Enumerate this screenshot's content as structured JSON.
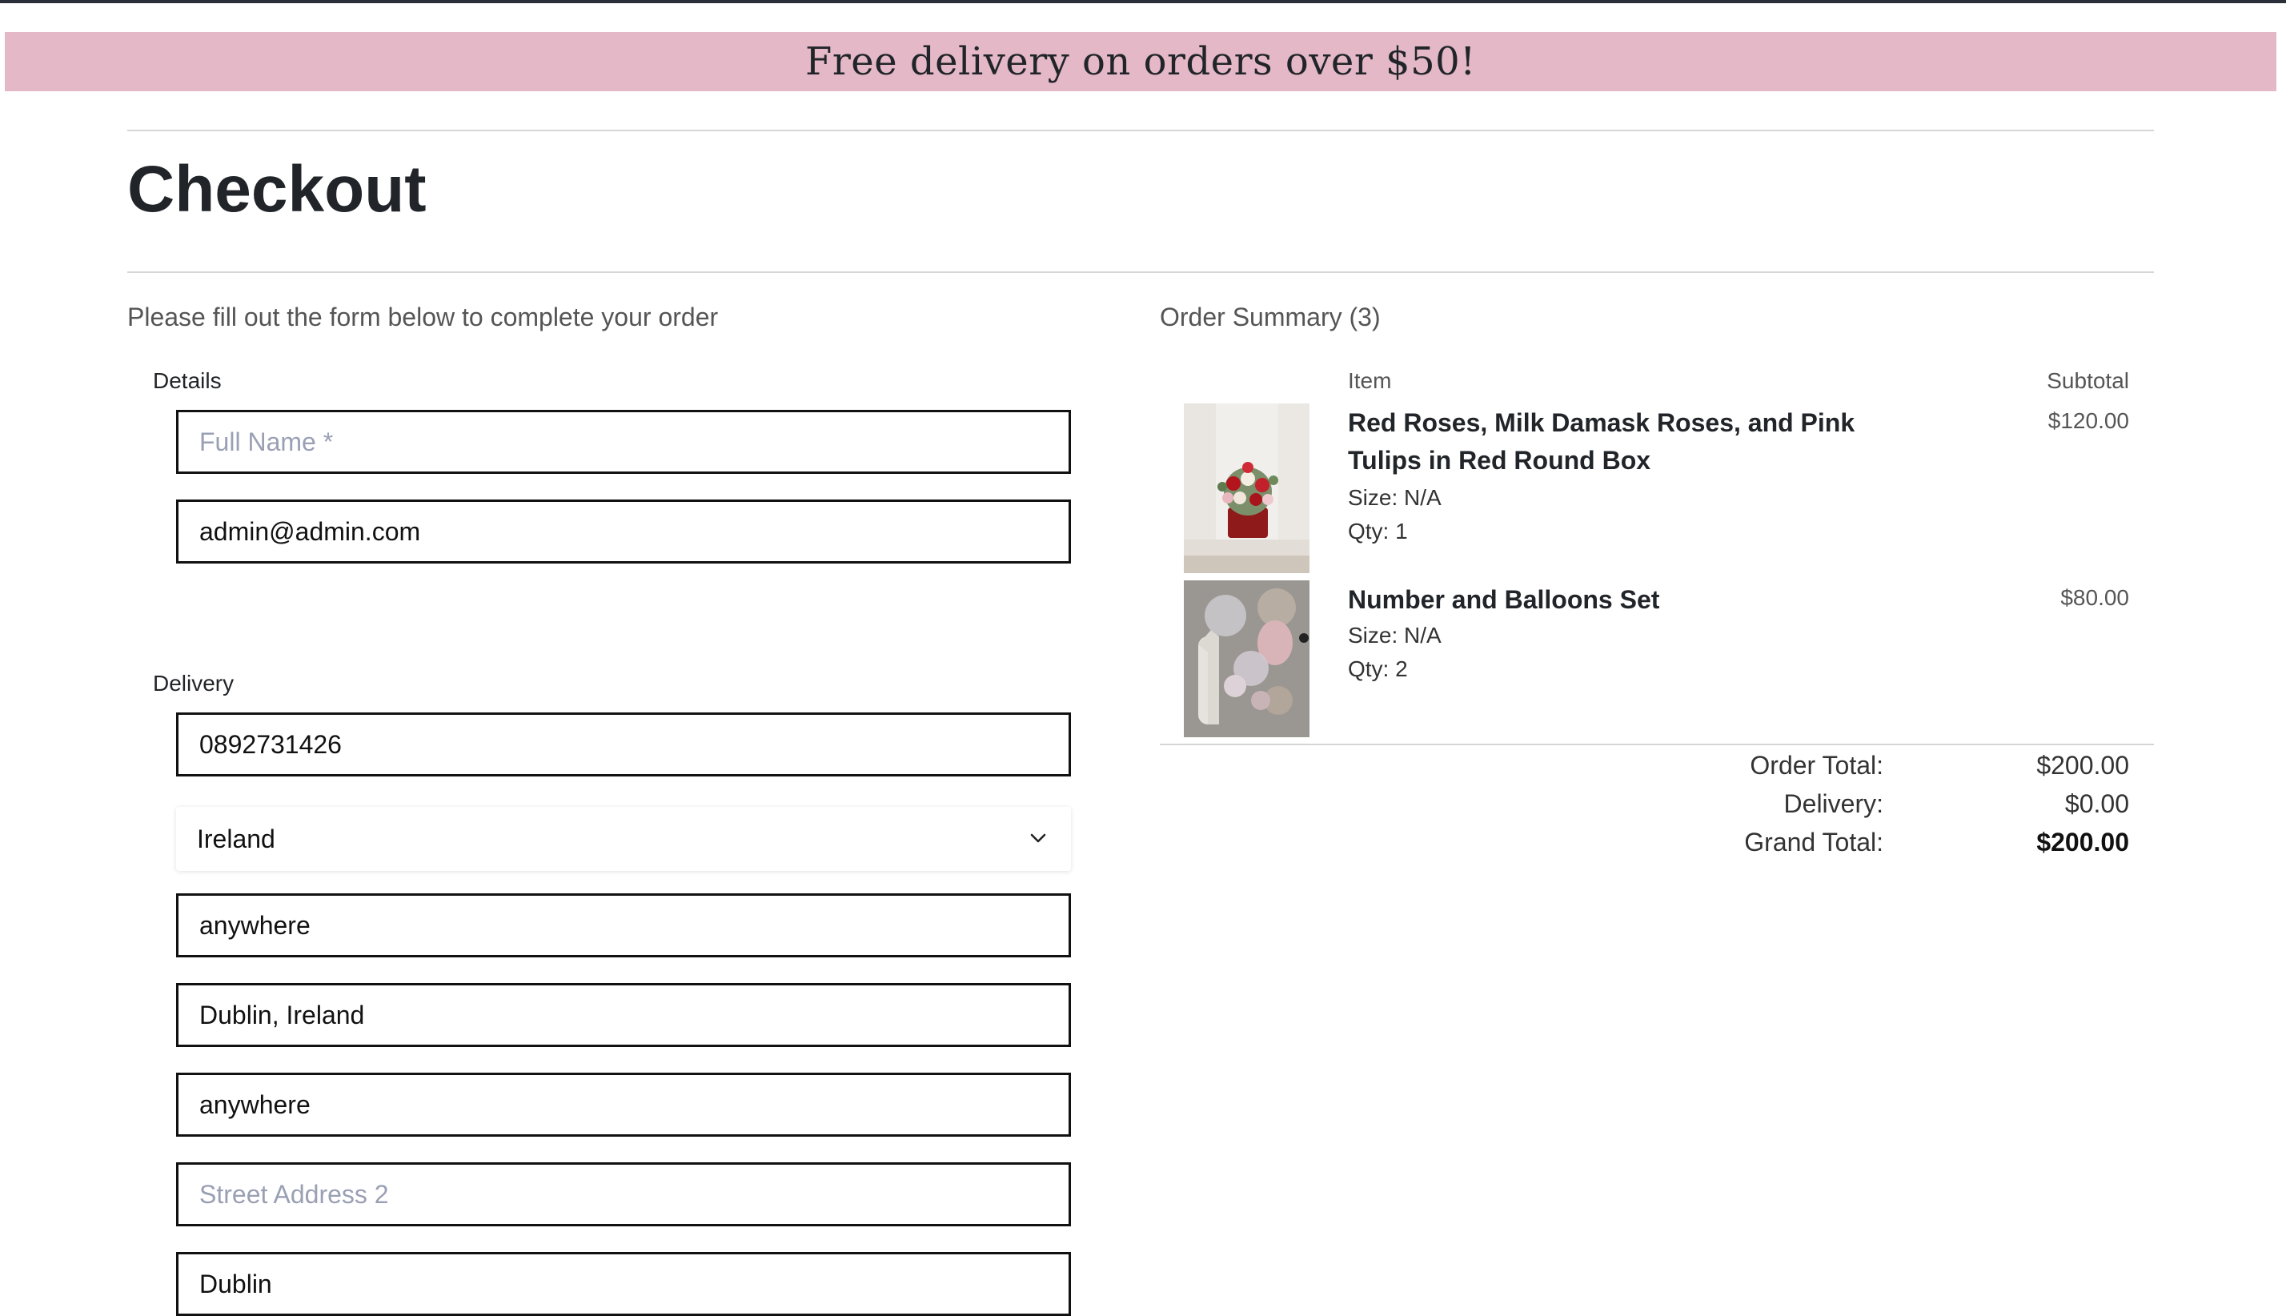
{
  "banner": {
    "text": "Free delivery on orders over $50!"
  },
  "page": {
    "title": "Checkout"
  },
  "form": {
    "intro": "Please fill out the form below to complete your order",
    "details_label": "Details",
    "delivery_label": "Delivery",
    "full_name": {
      "value": "",
      "placeholder": "Full Name *"
    },
    "email": {
      "value": "admin@admin.com"
    },
    "phone": {
      "value": "0892731426"
    },
    "country": {
      "selected": "Ireland"
    },
    "postcode": {
      "value": "anywhere"
    },
    "town": {
      "value": "Dublin, Ireland"
    },
    "street1": {
      "value": "anywhere"
    },
    "street2": {
      "value": "",
      "placeholder": "Street Address 2"
    },
    "county": {
      "value": "Dublin"
    }
  },
  "summary": {
    "title": "Order Summary (3)",
    "col_item": "Item",
    "col_subtotal": "Subtotal",
    "items": [
      {
        "name_line1": "Red Roses, Milk Damask Roses, and Pink",
        "name_line2": "Tulips in Red Round Box",
        "size": "Size: N/A",
        "qty": "Qty: 1",
        "price": "$120.00",
        "image": "roses-in-red-box"
      },
      {
        "name_line1": "Number and Balloons Set",
        "size": "Size: N/A",
        "qty": "Qty: 2",
        "price": "$80.00",
        "image": "number-and-balloons"
      }
    ],
    "totals": {
      "order_total_label": "Order Total:",
      "order_total": "$200.00",
      "delivery_label": "Delivery:",
      "delivery": "$0.00",
      "grand_total_label": "Grand Total:",
      "grand_total": "$200.00"
    }
  },
  "colors": {
    "banner_bg": "#e4b8c6",
    "text": "#212529",
    "muted": "#555555",
    "placeholder": "#9aa0b4"
  }
}
